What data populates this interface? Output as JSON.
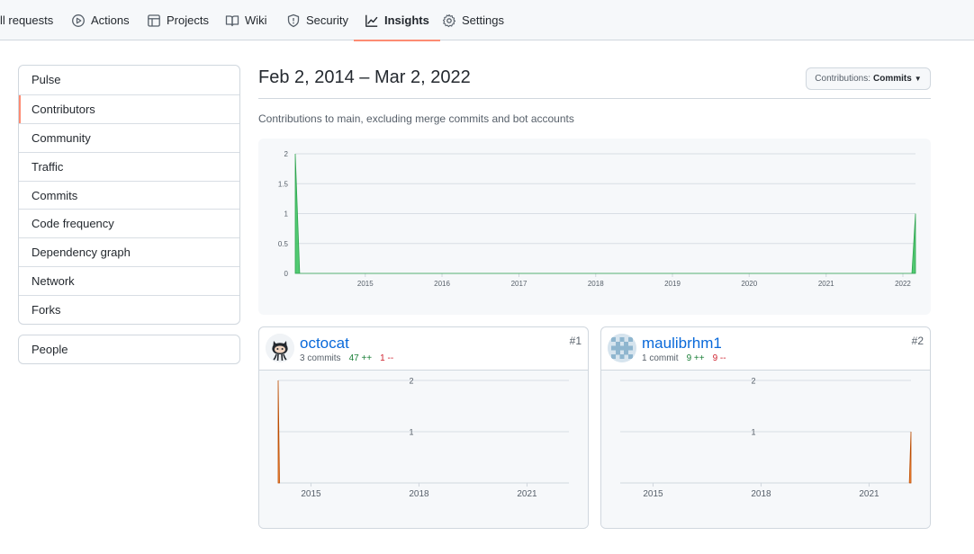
{
  "nav": {
    "tabs": [
      {
        "label": "ll requests",
        "icon": "pull-request-icon"
      },
      {
        "label": "Actions",
        "icon": "play-icon"
      },
      {
        "label": "Projects",
        "icon": "table-icon"
      },
      {
        "label": "Wiki",
        "icon": "book-icon"
      },
      {
        "label": "Security",
        "icon": "shield-icon"
      },
      {
        "label": "Insights",
        "icon": "graph-icon",
        "selected": true
      },
      {
        "label": "Settings",
        "icon": "gear-icon"
      }
    ]
  },
  "sidebar": {
    "items": [
      {
        "label": "Pulse"
      },
      {
        "label": "Contributors",
        "selected": true
      },
      {
        "label": "Community"
      },
      {
        "label": "Traffic"
      },
      {
        "label": "Commits"
      },
      {
        "label": "Code frequency"
      },
      {
        "label": "Dependency graph"
      },
      {
        "label": "Network"
      },
      {
        "label": "Forks"
      }
    ],
    "people_label": "People"
  },
  "header": {
    "date_range": "Feb 2, 2014 – Mar 2, 2022",
    "contributions_prefix": "Contributions:",
    "contributions_value": "Commits",
    "subtitle": "Contributions to main, excluding merge commits and bot accounts"
  },
  "colors": {
    "accent_underline": "#fd8c73",
    "main_area": "#40c463",
    "contributor_area": "#fb8532",
    "link": "#0969da"
  },
  "chart_data": [
    {
      "type": "area",
      "title": "",
      "y_ticks": [
        "0",
        "0.5",
        "1",
        "1.5",
        "2"
      ],
      "x_ticks": [
        "2015",
        "2016",
        "2017",
        "2018",
        "2019",
        "2020",
        "2021",
        "2022"
      ],
      "xlim": [
        "2014-02-02",
        "2022-03-02"
      ],
      "ylim": [
        0,
        2
      ],
      "series": [
        {
          "points": [
            {
              "x": "2014-02-02",
              "y": 2
            },
            {
              "x": "2014-02-23",
              "y": 0
            },
            {
              "x": "2022-02-13",
              "y": 0
            },
            {
              "x": "2022-03-02",
              "y": 1
            }
          ]
        }
      ],
      "grid": true
    }
  ],
  "contributors": [
    {
      "name": "octocat",
      "rank": "#1",
      "commits": "3 commits",
      "additions": "47 ++",
      "deletions": "1 --",
      "avatar_icon": "octocat-avatar-icon",
      "chart": {
        "type": "area",
        "y_ticks": [
          "1",
          "2"
        ],
        "x_ticks": [
          "2015",
          "2018",
          "2021"
        ],
        "ylim": [
          0,
          2
        ],
        "points": [
          {
            "x": "2014-02-02",
            "y": 2
          },
          {
            "x": "2014-02-16",
            "y": 0
          }
        ]
      }
    },
    {
      "name": "maulibrhm1",
      "rank": "#2",
      "commits": "1 commit",
      "additions": "9 ++",
      "deletions": "9 --",
      "avatar_icon": "identicon-avatar-icon",
      "chart": {
        "type": "area",
        "y_ticks": [
          "1",
          "2"
        ],
        "x_ticks": [
          "2015",
          "2018",
          "2021"
        ],
        "ylim": [
          0,
          2
        ],
        "points": [
          {
            "x": "2022-02-13",
            "y": 0
          },
          {
            "x": "2022-03-02",
            "y": 1
          }
        ]
      }
    }
  ]
}
